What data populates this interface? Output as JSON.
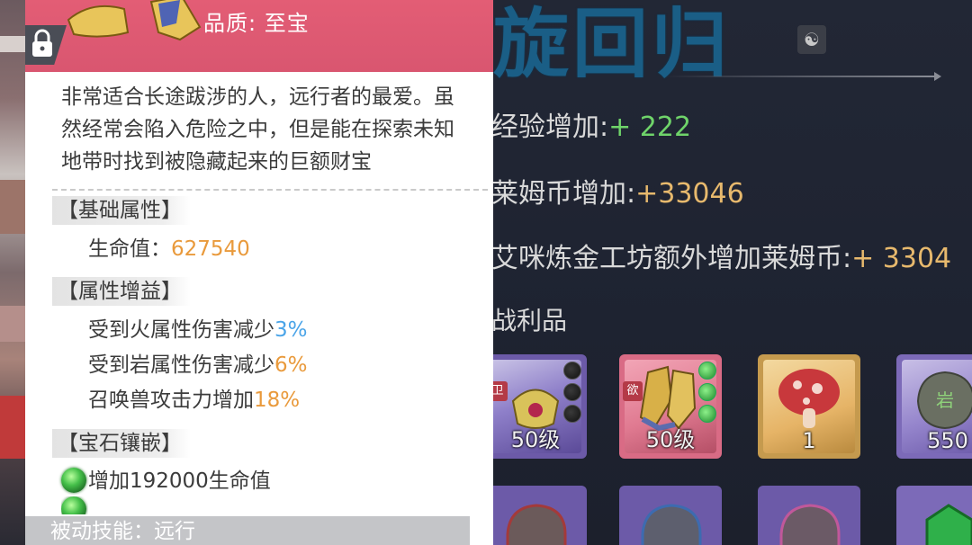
{
  "tooltip": {
    "quality_label": "品质: 至宝",
    "description": "非常适合长途跋涉的人，远行者的最爱。虽然经常会陷入危险之中，但是能在探索未知地带时找到被隐藏起来的巨额财宝",
    "base_section": "【基础属性】",
    "base_stats": [
      {
        "label": "生命值：",
        "value": "627540"
      }
    ],
    "bonus_section": "【属性增益】",
    "bonuses": [
      {
        "label": "受到火属性伤害减少",
        "value": "3%",
        "color": "#4aa4e8"
      },
      {
        "label": "受到岩属性伤害减少",
        "value": "6%",
        "color": "#e99a3c"
      },
      {
        "label": "召唤兽攻击力增加",
        "value": "18%",
        "color": "#e99a3c"
      }
    ],
    "gem_section": "【宝石镶嵌】",
    "gems": [
      {
        "text": "增加192000生命值"
      }
    ],
    "passive_skill": "被动技能：远行"
  },
  "result_panel": {
    "banner_title": "旋回归",
    "stats": [
      {
        "label": "经验增加:",
        "value": "+ 222",
        "color": "#6fd46a"
      },
      {
        "label": "莱姆币增加:",
        "value": "+33046",
        "color": "#e7b96d"
      },
      {
        "label": "艾咪炼金工坊额外增加莱姆币:",
        "value": "+ 3304",
        "color": "#e7b96d"
      }
    ],
    "loot_title": "战利品",
    "loot": [
      {
        "name": "accessory",
        "level": "50级",
        "tag": "卫",
        "rarity": "purple"
      },
      {
        "name": "boots",
        "level": "50级",
        "tag": "欲",
        "rarity": "red"
      },
      {
        "name": "mushroom",
        "level": "1",
        "rarity": "gold"
      },
      {
        "name": "rock",
        "level": "550",
        "rarity": "purple"
      }
    ]
  },
  "colors": {
    "header_pink": "#e35d75",
    "banner_blue": "#1a5e86",
    "green_value": "#6fd46a",
    "gold_value": "#e7b96d"
  }
}
